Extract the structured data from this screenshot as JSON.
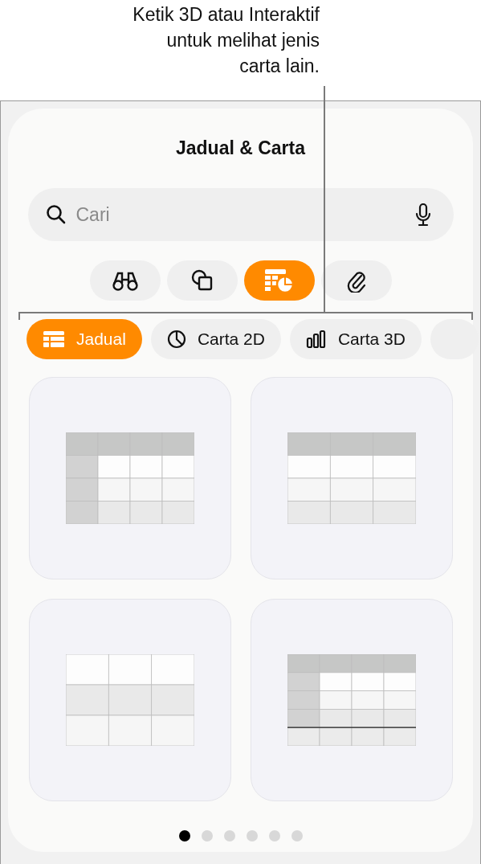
{
  "callout": {
    "lines": [
      "Ketik 3D atau Interaktif",
      "untuk melihat jenis",
      "carta lain."
    ]
  },
  "title": "Jadual & Carta",
  "search": {
    "placeholder": "Cari"
  },
  "category_tabs": [
    {
      "selected": false
    },
    {
      "selected": false
    },
    {
      "selected": true
    },
    {
      "selected": false
    }
  ],
  "chart_tabs": [
    {
      "label": "Jadual",
      "selected": true
    },
    {
      "label": "Carta 2D",
      "selected": false
    },
    {
      "label": "Carta 3D",
      "selected": false
    }
  ],
  "templates": [
    {
      "kind": "header-row-column"
    },
    {
      "kind": "header-row"
    },
    {
      "kind": "plain"
    },
    {
      "kind": "header-column-footer"
    }
  ],
  "page_dots": [
    {
      "selected": true
    },
    {
      "selected": false
    },
    {
      "selected": false
    },
    {
      "selected": false
    },
    {
      "selected": false
    },
    {
      "selected": false
    }
  ]
}
